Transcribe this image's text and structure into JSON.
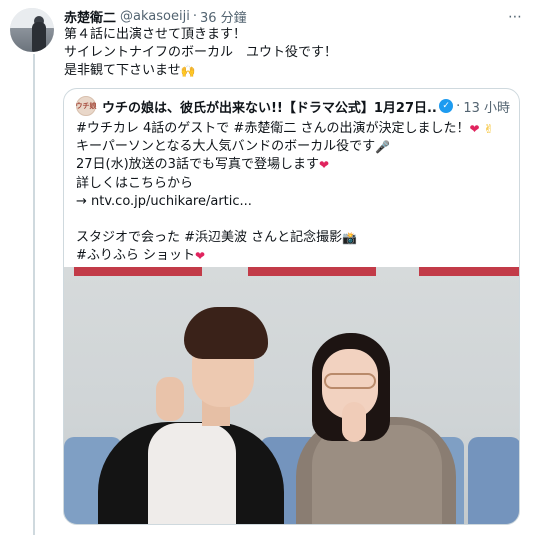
{
  "tweet": {
    "display_name": "赤楚衛二",
    "handle": "@akasoeiji",
    "separator": "·",
    "time": "36 分鐘",
    "more_icon": "⋯",
    "lines": [
      "第４話に出演させて頂きます！",
      "サイレントナイフのボーカル　ユウト役です！",
      "是非観て下さいませ"
    ],
    "line3_emoji": "🙌"
  },
  "quoted": {
    "avatar_text": "ウチ娘",
    "display_name": "ウチの娘は、彼氏が出来ない!!【ドラマ公式】1月27日...",
    "verified_icon": "✓",
    "separator": "·",
    "time": "13 小時",
    "line1": "#ウチカレ 4話のゲストで #赤楚衛二 さんの出演が決定しました！",
    "line2": "キーパーソンとなる大人気バンドのボーカル役です",
    "line3": "27日(水)放送の3話でも写真で登場します",
    "line4": "詳しくはこちらから",
    "line5": "→ ntv.co.jp/uchikare/artic...",
    "line6": "スタジオで会った #浜辺美波 さんと記念撮影",
    "line7": "#ふりふら ショット",
    "emoji_heart": "❤",
    "emoji_peace": "✌",
    "emoji_mic": "🎤",
    "emoji_camera": "📸"
  },
  "colors": {
    "accent_blue": "#1d9bf0",
    "text_primary": "#0f1419",
    "text_secondary": "#536471",
    "border": "#cfd9de",
    "heart_red": "#e0245e"
  },
  "icons": {
    "more": "more-options-icon",
    "verified": "verified-badge-icon"
  }
}
